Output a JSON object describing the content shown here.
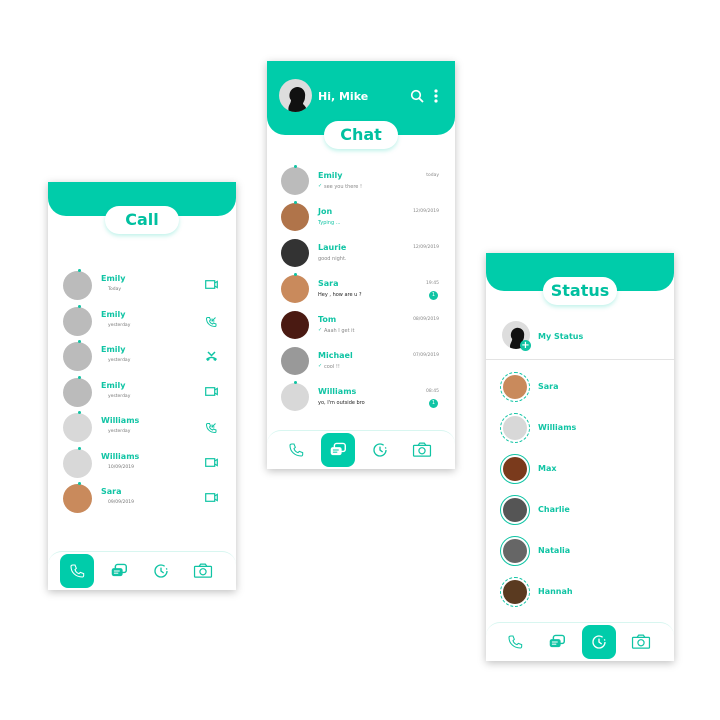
{
  "call_screen": {
    "title": "Call",
    "items": [
      {
        "name": "Emily",
        "time": "Today",
        "icon": "video-icon"
      },
      {
        "name": "Emily",
        "time": "yesterday",
        "icon": "incoming-call-icon"
      },
      {
        "name": "Emily",
        "time": "yesterday",
        "icon": "missed-call-icon"
      },
      {
        "name": "Emily",
        "time": "yesterday",
        "icon": "video-icon"
      },
      {
        "name": "Williams",
        "time": "yesterday",
        "icon": "incoming-call-icon"
      },
      {
        "name": "Williams",
        "time": "10/09/2019",
        "icon": "video-icon"
      },
      {
        "name": "Sara",
        "time": "09/09/2019",
        "icon": "video-icon"
      }
    ],
    "active_tab": "calls"
  },
  "chat_screen": {
    "greeting": "Hi, Mike",
    "title": "Chat",
    "items": [
      {
        "name": "Emily",
        "message": "see you there !",
        "time": "today",
        "read": true,
        "unread": null
      },
      {
        "name": "Jon",
        "message": "Typing ...",
        "time": "12/09/2019",
        "read": false,
        "unread": null
      },
      {
        "name": "Laurie",
        "message": "good night.",
        "time": "12/09/2019",
        "read": false,
        "unread": null
      },
      {
        "name": "Sara",
        "message": "Hey , how are u ?",
        "time": "19:45",
        "read": false,
        "unread": "1"
      },
      {
        "name": "Tom",
        "message": "Aaah I get it",
        "time": "08/09/2019",
        "read": true,
        "unread": null
      },
      {
        "name": "Michael",
        "message": "cool !!",
        "time": "07/09/2019",
        "read": true,
        "unread": null
      },
      {
        "name": "Williams",
        "message": "yo,  I'm outside bro",
        "time": "08:45",
        "read": false,
        "unread": "1"
      }
    ],
    "active_tab": "chats"
  },
  "status_screen": {
    "title": "Status",
    "my_status": "My Status",
    "items": [
      "Sara",
      "Williams",
      "Max",
      "Charlie",
      "Natalia",
      "Hannah"
    ],
    "active_tab": "status"
  },
  "colors": {
    "accent": "#00ccaa",
    "text_accent": "#10c4a4"
  }
}
